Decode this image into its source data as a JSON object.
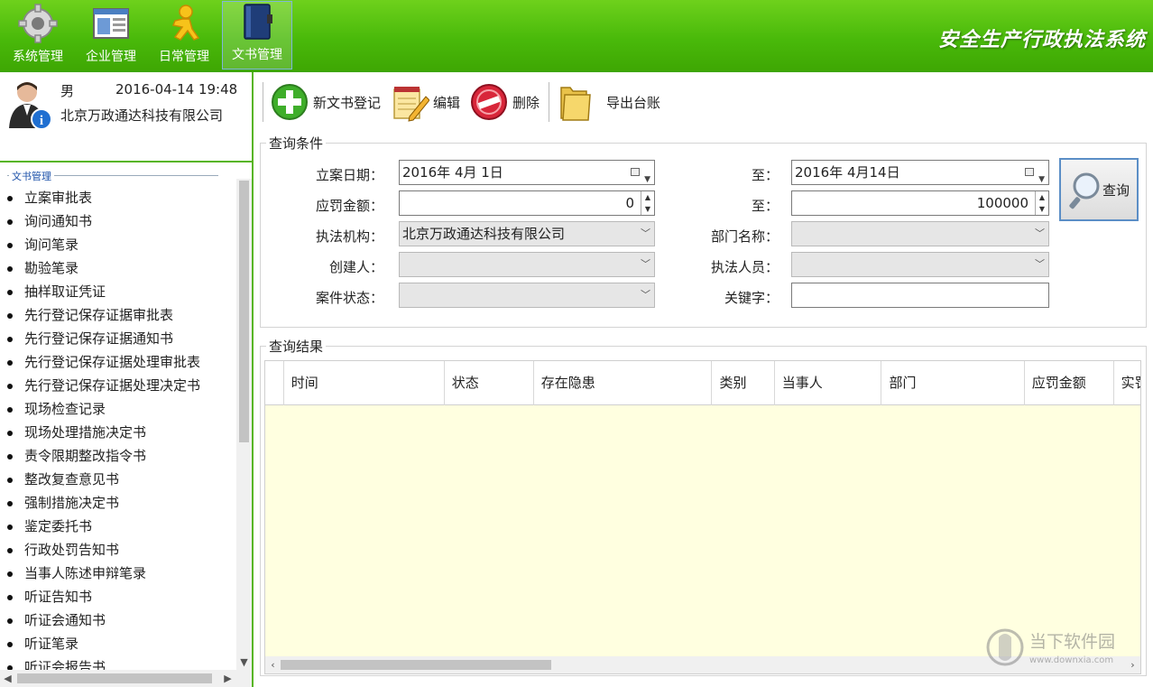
{
  "app_title": "安全生产行政执法系统",
  "nav": [
    {
      "label": "系统管理",
      "icon": "gear-icon"
    },
    {
      "label": "企业管理",
      "icon": "window-icon"
    },
    {
      "label": "日常管理",
      "icon": "runner-icon"
    },
    {
      "label": "文书管理",
      "icon": "book-icon",
      "active": true
    }
  ],
  "user": {
    "gender": "男",
    "datetime": "2016-04-14 19:48",
    "company": "北京万政通达科技有限公司"
  },
  "tree": {
    "title": "文书管理",
    "items": [
      "立案审批表",
      "询问通知书",
      "询问笔录",
      "勘验笔录",
      "抽样取证凭证",
      "先行登记保存证据审批表",
      "先行登记保存证据通知书",
      "先行登记保存证据处理审批表",
      "先行登记保存证据处理决定书",
      "现场检查记录",
      "现场处理措施决定书",
      "责令限期整改指令书",
      "整改复查意见书",
      "强制措施决定书",
      "鉴定委托书",
      "行政处罚告知书",
      "当事人陈述申辩笔录",
      "听证告知书",
      "听证会通知书",
      "听证笔录",
      "听证会报告书"
    ]
  },
  "toolbar": {
    "new_label": "新文书登记",
    "edit_label": "编辑",
    "delete_label": "删除",
    "export_label": "导出台账"
  },
  "query": {
    "legend": "查询条件",
    "date_label": "立案日期：",
    "date_from": "2016年  4月  1日",
    "date_to_label": "至：",
    "date_to": "2016年  4月14日",
    "amount_label": "应罚金额：",
    "amount_from": "0",
    "amount_to_label": "至：",
    "amount_to": "100000",
    "agency_label": "执法机构：",
    "agency_value": "北京万政通达科技有限公司",
    "dept_label": "部门名称：",
    "dept_value": "",
    "creator_label": "创建人：",
    "creator_value": "",
    "officer_label": "执法人员：",
    "officer_value": "",
    "status_label": "案件状态：",
    "status_value": "",
    "keyword_label": "关键字：",
    "keyword_value": "",
    "search_label": "查询"
  },
  "results": {
    "legend": "查询结果",
    "columns": [
      "时间",
      "状态",
      "存在隐患",
      "类别",
      "当事人",
      "部门",
      "应罚金额",
      "实罚"
    ]
  },
  "watermark": {
    "text": "当下软件园",
    "url": "www.downxia.com"
  }
}
